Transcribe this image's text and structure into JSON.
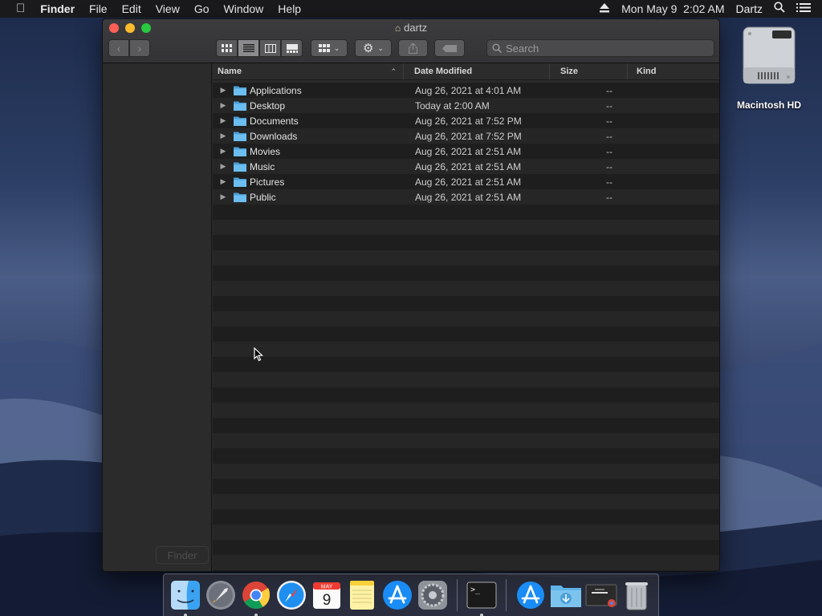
{
  "menubar": {
    "apple_icon": "apple-logo-icon",
    "app_name": "Finder",
    "items": [
      "File",
      "Edit",
      "View",
      "Go",
      "Window",
      "Help"
    ],
    "clock": "Mon May 9  2:02 AM",
    "user": "Dartz",
    "eject_icon": "eject-icon",
    "spotlight_icon": "search-icon",
    "notification_icon": "list-icon"
  },
  "desktop": {
    "drive_label": "Macintosh HD"
  },
  "window": {
    "title": "dartz",
    "search_placeholder": "Search",
    "columns": {
      "name": "Name",
      "date": "Date Modified",
      "size": "Size",
      "kind": "Kind"
    },
    "rows": [
      {
        "name": "Applications",
        "date": "Aug 26, 2021 at 4:01 AM",
        "size": "--",
        "kind": ""
      },
      {
        "name": "Desktop",
        "date": "Today at 2:00 AM",
        "size": "--",
        "kind": ""
      },
      {
        "name": "Documents",
        "date": "Aug 26, 2021 at 7:52 PM",
        "size": "--",
        "kind": ""
      },
      {
        "name": "Downloads",
        "date": "Aug 26, 2021 at 7:52 PM",
        "size": "--",
        "kind": ""
      },
      {
        "name": "Movies",
        "date": "Aug 26, 2021 at 2:51 AM",
        "size": "--",
        "kind": ""
      },
      {
        "name": "Music",
        "date": "Aug 26, 2021 at 2:51 AM",
        "size": "--",
        "kind": ""
      },
      {
        "name": "Pictures",
        "date": "Aug 26, 2021 at 2:51 AM",
        "size": "--",
        "kind": ""
      },
      {
        "name": "Public",
        "date": "Aug 26, 2021 at 2:51 AM",
        "size": "--",
        "kind": ""
      }
    ],
    "sidebar_ghost_label": "Finder"
  },
  "dock": {
    "calendar_month": "MAY",
    "calendar_day": "9",
    "apps": [
      "finder",
      "launchpad",
      "chrome",
      "safari",
      "calendar",
      "notes",
      "app-store",
      "system-preferences",
      "terminal",
      "app-store-downloads",
      "downloads-folder",
      "chrome-window",
      "trash"
    ]
  },
  "colors": {
    "folder_blue": "#5fb4e8",
    "window_bg": "#1e1e1e",
    "accent": "#3b8ee0"
  }
}
